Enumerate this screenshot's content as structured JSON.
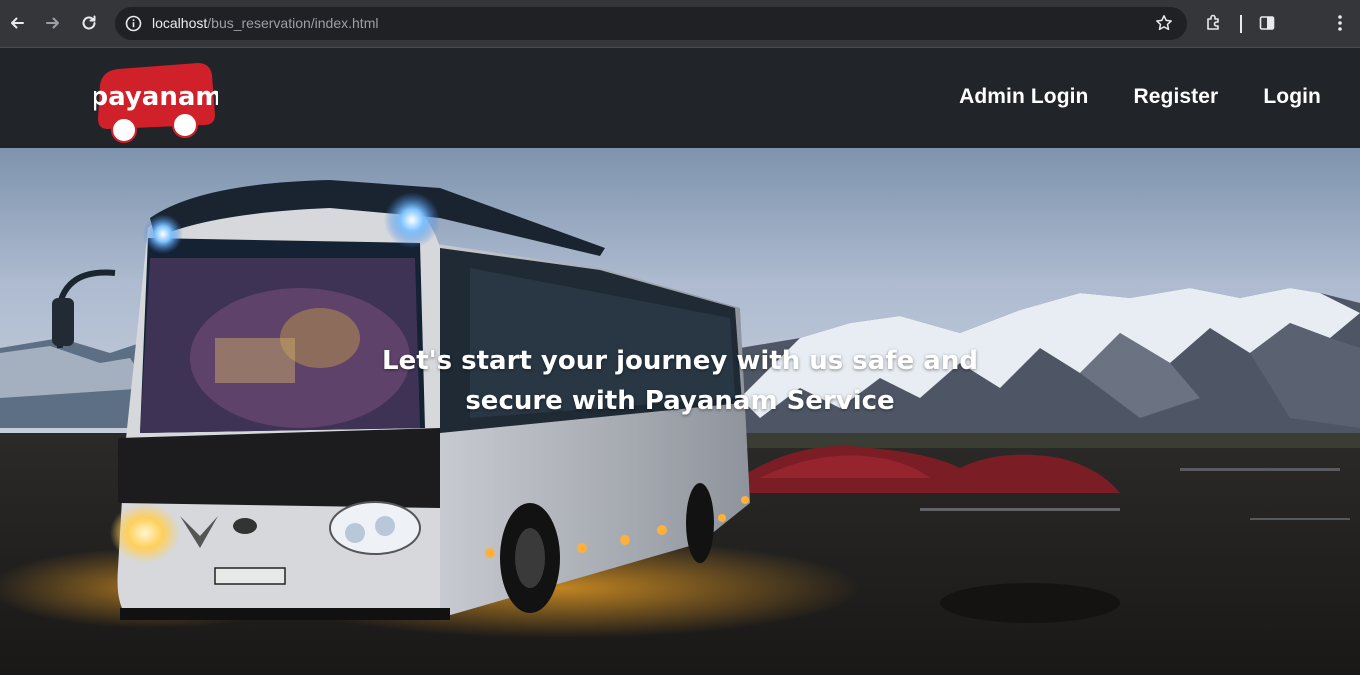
{
  "browser": {
    "url_host": "localhost",
    "url_path": "/bus_reservation/index.html"
  },
  "site": {
    "logo_text": "payanam",
    "nav": [
      {
        "label": "Admin Login"
      },
      {
        "label": "Register"
      },
      {
        "label": "Login"
      }
    ]
  },
  "hero": {
    "heading_line1": "Let's start your journey with us safe and",
    "heading_line2": "secure with Payanam Service"
  },
  "colors": {
    "logo_red": "#d0202a",
    "header_bg": "#212529"
  }
}
